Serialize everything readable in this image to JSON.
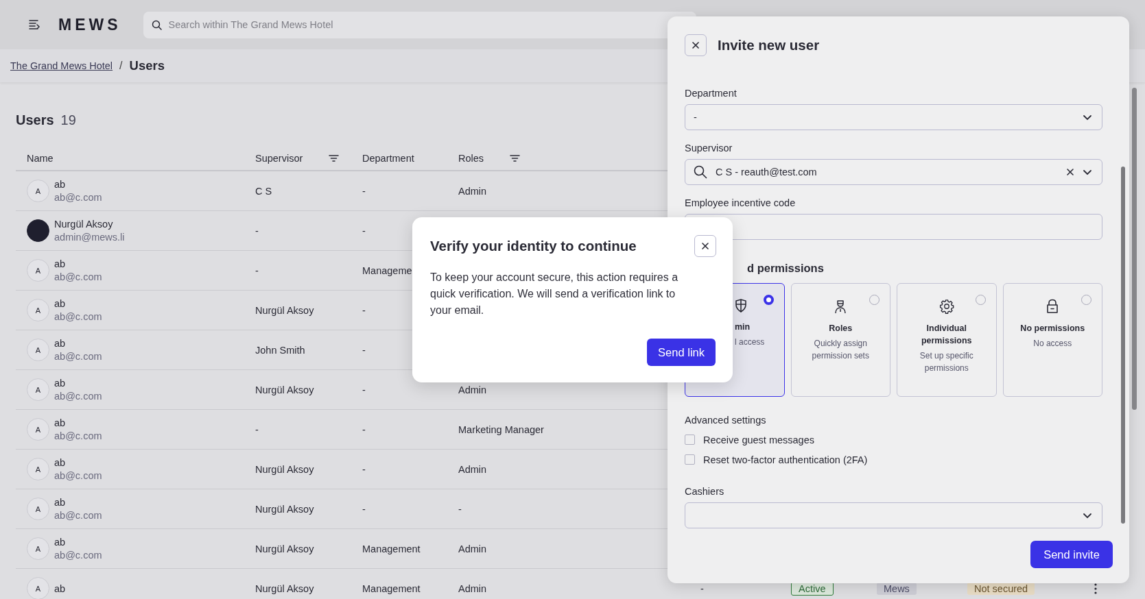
{
  "top_bar": {
    "logo": "MEWS",
    "search": {
      "placeholder": "Search within The Grand Mews Hotel"
    }
  },
  "breadcrumb": {
    "link": "The Grand Mews Hotel",
    "separator": "/",
    "current": "Users"
  },
  "page": {
    "title": "Users",
    "count": "19"
  },
  "table": {
    "columns": [
      {
        "label": "Name",
        "filter": false
      },
      {
        "label": "Supervisor",
        "filter": true
      },
      {
        "label": "Department",
        "filter": false
      },
      {
        "label": "Roles",
        "filter": true
      }
    ],
    "rows": [
      {
        "avatar": {
          "kind": "initial",
          "text": "A"
        },
        "name": "ab",
        "email": "ab@c.com",
        "supervisor": "C S",
        "department": "-",
        "roles": "Admin"
      },
      {
        "avatar": {
          "kind": "image"
        },
        "name": "Nurgül Aksoy",
        "email": "admin@mews.li",
        "supervisor": "-",
        "department": "-"
      },
      {
        "avatar": {
          "kind": "initial",
          "text": "A"
        },
        "name": "ab",
        "email": "ab@c.com",
        "supervisor": "-",
        "department": "Manageme"
      },
      {
        "avatar": {
          "kind": "initial",
          "text": "A"
        },
        "name": "ab",
        "email": "ab@c.com",
        "supervisor": "Nurgül Aksoy",
        "department": "-"
      },
      {
        "avatar": {
          "kind": "initial",
          "text": "A"
        },
        "name": "ab",
        "email": "ab@c.com",
        "supervisor": "John Smith",
        "department": "-"
      },
      {
        "avatar": {
          "kind": "initial",
          "text": "A"
        },
        "name": "ab",
        "email": "ab@c.com",
        "supervisor": "Nurgül Aksoy",
        "department": "-",
        "roles": "Admin"
      },
      {
        "avatar": {
          "kind": "initial",
          "text": "A"
        },
        "name": "ab",
        "email": "ab@c.com",
        "supervisor": "-",
        "department": "-",
        "roles": "Marketing Manager"
      },
      {
        "avatar": {
          "kind": "initial",
          "text": "A"
        },
        "name": "ab",
        "email": "ab@c.com",
        "supervisor": "Nurgül Aksoy",
        "department": "-",
        "roles": "Admin"
      },
      {
        "avatar": {
          "kind": "initial",
          "text": "A"
        },
        "name": "ab",
        "email": "ab@c.com",
        "supervisor": "Nurgül Aksoy",
        "department": "-",
        "roles": "-"
      },
      {
        "avatar": {
          "kind": "initial",
          "text": "A"
        },
        "name": "ab",
        "email": "ab@c.com",
        "supervisor": "Nurgül Aksoy",
        "department": "Management",
        "roles": "Admin"
      },
      {
        "avatar": {
          "kind": "initial",
          "text": "A"
        },
        "name": "ab",
        "supervisor": "Nurgül Aksoy",
        "department": "Management",
        "roles": "Admin",
        "extra_cells": [
          {
            "kind": "text",
            "text": "-"
          },
          {
            "kind": "success",
            "text": "Active"
          },
          {
            "kind": "tag",
            "text": "Mews"
          },
          {
            "kind": "warning",
            "text": "Not secured"
          }
        ],
        "more_menu": true
      }
    ]
  },
  "invite_panel": {
    "title": "Invite new user",
    "fields": [
      {
        "kind": "select",
        "label": "Department",
        "value": "-"
      },
      {
        "kind": "search_select",
        "label": "Supervisor",
        "value": "C S - reauth@test.com",
        "clearable": true
      },
      {
        "kind": "text",
        "label": "Employee incentive code"
      }
    ],
    "permissions": {
      "title": "d permissions",
      "partial": true,
      "options": [
        {
          "title": "min",
          "description": "l access",
          "selected": true,
          "partial": true
        },
        {
          "title": "Roles",
          "description": "Quickly assign permission sets",
          "selected": false,
          "partial": false
        },
        {
          "title": "Individual permissions",
          "description": "Set up specific permissions",
          "selected": false,
          "partial": false
        },
        {
          "title": "No permissions",
          "description": "No access",
          "selected": false,
          "partial": false
        }
      ]
    },
    "advanced": {
      "title": "Advanced settings",
      "options": [
        {
          "label": "Receive guest messages",
          "checked": false
        },
        {
          "label": "Reset two-factor authentication (2FA)",
          "checked": false
        }
      ]
    },
    "cashiers": {
      "label": "Cashiers"
    },
    "submit": "Send invite"
  },
  "verify_dialog": {
    "title": "Verify your identity to continue",
    "body": "To keep your account secure, this action requires a quick verification. We will send a verification link to your email.",
    "action": "Send link"
  }
}
